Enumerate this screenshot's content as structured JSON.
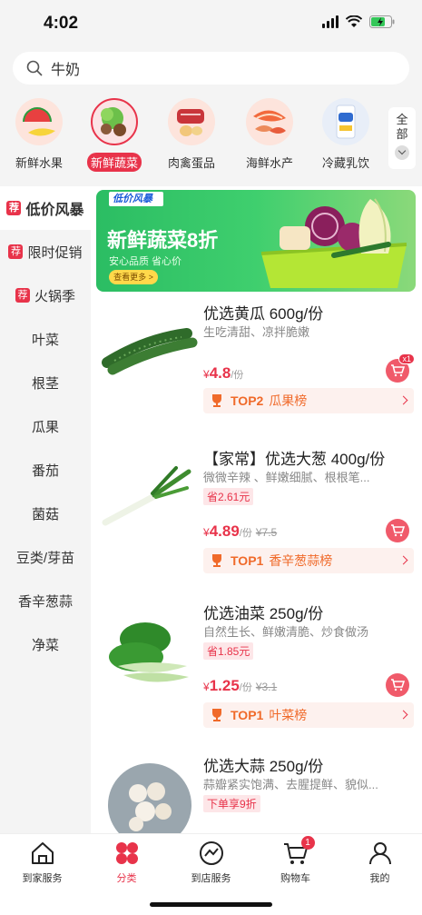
{
  "status": {
    "time": "4:02"
  },
  "search": {
    "value": "牛奶",
    "placeholder": ""
  },
  "categories": [
    {
      "label": "新鲜水果",
      "icon": "fruit-icon",
      "active": false
    },
    {
      "label": "新鲜蔬菜",
      "icon": "vegetable-icon",
      "active": true
    },
    {
      "label": "肉禽蛋品",
      "icon": "meat-icon",
      "active": false
    },
    {
      "label": "海鲜水产",
      "icon": "seafood-icon",
      "active": false
    },
    {
      "label": "冷藏乳饮",
      "icon": "dairy-icon",
      "active": false
    }
  ],
  "categories_more": {
    "label": "全部"
  },
  "sidebar": {
    "items": [
      {
        "label": "低价风暴",
        "tag": "荐",
        "active": true
      },
      {
        "label": "限时促销",
        "tag": "荐",
        "active": false
      },
      {
        "label": "火锅季",
        "tag": "荐",
        "active": false
      },
      {
        "label": "叶菜",
        "tag": "",
        "active": false
      },
      {
        "label": "根茎",
        "tag": "",
        "active": false
      },
      {
        "label": "瓜果",
        "tag": "",
        "active": false
      },
      {
        "label": "番茄",
        "tag": "",
        "active": false
      },
      {
        "label": "菌菇",
        "tag": "",
        "active": false
      },
      {
        "label": "豆类/芽苗",
        "tag": "",
        "active": false
      },
      {
        "label": "香辛葱蒜",
        "tag": "",
        "active": false
      },
      {
        "label": "净菜",
        "tag": "",
        "active": false
      }
    ]
  },
  "banner": {
    "logo": "低价风暴",
    "title": "新鲜蔬菜8折",
    "subtitle": "安心品质  省心价",
    "button": "查看更多 >"
  },
  "products": [
    {
      "name": "优选黄瓜 600g/份",
      "desc": "生吃清甜、凉拌脆嫩",
      "save": "",
      "price_symbol": "¥",
      "price": "4.8",
      "unit": "/份",
      "old_price": "",
      "cart_badge": "x1",
      "rank": "TOP2",
      "rank_label": "瓜果榜",
      "image": "cucumber-image"
    },
    {
      "name": "【家常】优选大葱 400g/份",
      "desc": "微微辛辣 、鲜嫩细腻、根根笔...",
      "save": "省2.61元",
      "price_symbol": "¥",
      "price": "4.89",
      "unit": "/份",
      "old_price": "¥7.5",
      "cart_badge": "",
      "rank": "TOP1",
      "rank_label": "香辛葱蒜榜",
      "image": "scallion-image"
    },
    {
      "name": "优选油菜 250g/份",
      "desc": "自然生长、鲜嫩清脆、炒食做汤",
      "save": "省1.85元",
      "price_symbol": "¥",
      "price": "1.25",
      "unit": "/份",
      "old_price": "¥3.1",
      "cart_badge": "",
      "rank": "TOP1",
      "rank_label": "叶菜榜",
      "image": "bokchoy-image"
    },
    {
      "name": "优选大蒜 250g/份",
      "desc": "蒜瓣紧实饱满、去腥提鲜、貌似...",
      "save": "下单享9折",
      "price_symbol": "",
      "price": "",
      "unit": "",
      "old_price": "",
      "cart_badge": "",
      "rank": "",
      "rank_label": "",
      "image": "garlic-image"
    }
  ],
  "tabbar": {
    "items": [
      {
        "label": "到家服务",
        "icon": "home-icon",
        "active": false,
        "badge": ""
      },
      {
        "label": "分类",
        "icon": "category-icon",
        "active": true,
        "badge": ""
      },
      {
        "label": "到店服务",
        "icon": "store-icon",
        "active": false,
        "badge": ""
      },
      {
        "label": "购物车",
        "icon": "cart-icon",
        "active": false,
        "badge": "1"
      },
      {
        "label": "我的",
        "icon": "profile-icon",
        "active": false,
        "badge": ""
      }
    ]
  },
  "colors": {
    "accent": "#e8334a",
    "rank": "#f06a2a",
    "banner": "#2bbd63"
  }
}
